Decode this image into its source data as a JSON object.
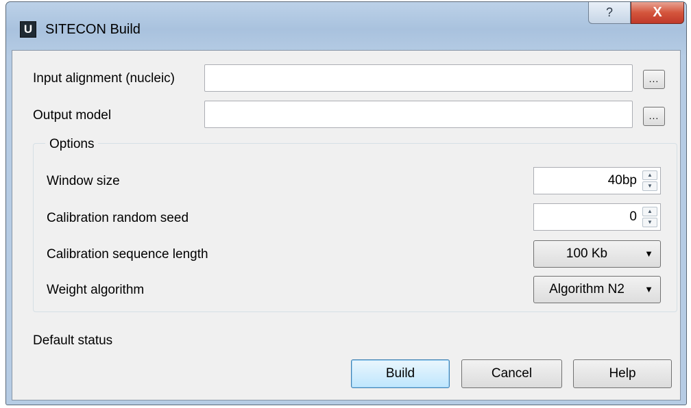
{
  "window": {
    "title": "SITECON Build",
    "app_icon_letter": "U",
    "help_glyph": "?",
    "close_glyph": "X"
  },
  "fields": {
    "input_label": "Input alignment (nucleic)",
    "input_value": "",
    "output_label": "Output model",
    "output_value": "",
    "browse_label": "..."
  },
  "options": {
    "title": "Options",
    "window_size_label": "Window size",
    "window_size_value": "40bp",
    "seed_label": "Calibration random seed",
    "seed_value": "0",
    "seq_length_label": "Calibration sequence length",
    "seq_length_value": "100 Kb",
    "weight_label": "Weight algorithm",
    "weight_value": "Algorithm N2"
  },
  "status": "Default status",
  "buttons": {
    "build": "Build",
    "cancel": "Cancel",
    "help": "Help"
  },
  "icons": {
    "spin_up": "▲",
    "spin_down": "▼",
    "dropdown": "▼"
  }
}
